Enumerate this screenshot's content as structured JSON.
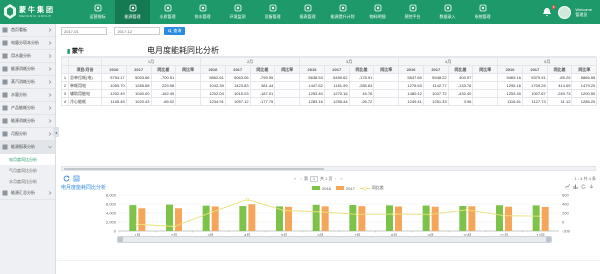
{
  "brand": {
    "name": "蒙牛集团",
    "sub": "MENGNIU GROUP",
    "primary_color": "#1e9a6a"
  },
  "nav": [
    {
      "label": "运营指标",
      "icon": "monitor-icon"
    },
    {
      "label": "能源管理",
      "icon": "bolt-icon",
      "active": true
    },
    {
      "label": "水质管理",
      "icon": "drop-icon"
    },
    {
      "label": "排水管理",
      "icon": "pipe-icon"
    },
    {
      "label": "环境监测",
      "icon": "leaf-icon"
    },
    {
      "label": "设备管理",
      "icon": "gear-icon"
    },
    {
      "label": "报表管理",
      "icon": "report-icon"
    },
    {
      "label": "能源提升计划",
      "icon": "chart-up-icon"
    },
    {
      "label": "物料明细",
      "icon": "box-icon"
    },
    {
      "label": "预控平台",
      "icon": "shield-icon"
    },
    {
      "label": "数据录入",
      "icon": "edit-icon"
    },
    {
      "label": "系统管理",
      "icon": "settings-icon"
    }
  ],
  "notifications": {
    "count": "8"
  },
  "user": {
    "greeting": "Welcome",
    "name": "管理员"
  },
  "sidebar": {
    "items": [
      {
        "label": "首页看板",
        "open": false
      },
      {
        "label": "电量分项本分析",
        "open": false
      },
      {
        "label": "用水量分析",
        "open": false
      },
      {
        "label": "能源消耗分析",
        "open": false
      },
      {
        "label": "蒸汽消耗分析",
        "open": false
      },
      {
        "label": "水量分析",
        "open": false
      },
      {
        "label": "产品能耗分析",
        "open": false
      },
      {
        "label": "能源消耗分析",
        "open": false
      },
      {
        "label": "月报分析",
        "open": false
      },
      {
        "label": "能源报表分析",
        "open": true
      }
    ],
    "subitems": [
      {
        "label": "电月度同比分析",
        "active": true
      },
      {
        "label": "气月度同比分析",
        "active": false
      },
      {
        "label": "水月度同比分析",
        "active": false
      }
    ],
    "last_item": {
      "label": "能源汇总分析"
    },
    "collapse_glyph": "◂"
  },
  "filter": {
    "start": "2017-01",
    "end": "2017-12",
    "dash": "-",
    "query_label": "查询"
  },
  "report": {
    "logo_green": "蒙牛",
    "logo_mark": "▮",
    "title": "电月度能耗同比分析"
  },
  "table": {
    "project_header": "项目/月份",
    "months": [
      "1月",
      "2月",
      "3月",
      "4月",
      "5月"
    ],
    "year_labels": [
      "2016",
      "2017",
      "同比差",
      "同比率"
    ],
    "rows": [
      {
        "no": "1",
        "name": "总单位耗(电)",
        "cells": [
          "5754.17",
          "5053.66",
          "-700.51",
          "",
          "5862.61",
          "5063.06",
          "-799.55",
          "",
          "5638.53",
          "5459.62",
          "-178.91",
          "",
          "5547.65",
          "5948.22",
          "400.57",
          "",
          "5469.16",
          "5379.91",
          "-89.25",
          "5866.55"
        ]
      },
      {
        "no": "2",
        "name": "单耗用电",
        "cells": [
          "1055.70",
          "1285.68",
          "229.98",
          "",
          "1042.39",
          "1423.83",
          "381.44",
          "",
          "1447.62",
          "1161.99",
          "-285.63",
          "",
          "1276.53",
          "1142.77",
          "-133.76",
          "",
          "1295.16",
          "1709.25",
          "414.09",
          "1479.20"
        ]
      },
      {
        "no": "3",
        "name": "辅助用能电",
        "cells": [
          "1202.49",
          "1040.00",
          "-162.49",
          "",
          "1202.04",
          "1015.03",
          "-187.01",
          "",
          "1253.40",
          "1270.16",
          "16.76",
          "",
          "1480.12",
          "1047.72",
          "-432.40",
          "",
          "1253.40",
          "1007.67",
          "-245.73",
          "1200.50"
        ]
      },
      {
        "no": "4",
        "name": "冷心能耗",
        "cells": [
          "1105.45",
          "1020.43",
          "-85.02",
          "",
          "1234.91",
          "1057.12",
          "-177.79",
          "",
          "1283.16",
          "1255.44",
          "-26.72",
          "",
          "1249.41",
          "1251.33",
          "3.96",
          "",
          "1116.61",
          "1127.73",
          "11.12",
          "1286.20"
        ]
      }
    ]
  },
  "pager": {
    "first": "«",
    "prev": "‹",
    "page_prefix": "第",
    "page": "1",
    "page_suffix": "共 1 页",
    "next": "›",
    "last": "»",
    "info": "1 - 4  共 4 条"
  },
  "chart_data": {
    "type": "bar",
    "title": "电月度能耗同比分析",
    "categories": [
      "1月",
      "2月",
      "3月",
      "4月",
      "5月",
      "6月",
      "7月",
      "8月",
      "9月",
      "10月",
      "11月",
      "12月"
    ],
    "series": [
      {
        "name": "2016",
        "type": "bar",
        "color": "#7dc34a",
        "values": [
          5754,
          5863,
          5639,
          5548,
          5469,
          5820,
          5780,
          5700,
          5650,
          5560,
          5720,
          5690
        ]
      },
      {
        "name": "2017",
        "type": "bar",
        "color": "#f6a65a",
        "values": [
          5054,
          5063,
          5460,
          5948,
          5380,
          5480,
          5520,
          5450,
          5390,
          5500,
          5400,
          5350
        ]
      },
      {
        "name": "同比差",
        "type": "line",
        "axis": "right",
        "color": "#e8e07a",
        "values": [
          -700,
          -800,
          -179,
          401,
          -89,
          -150,
          -260,
          -250,
          -260,
          -60,
          -320,
          -340
        ]
      }
    ],
    "ylabels_left": [
      "8,000",
      "6,000",
      "4,000",
      "2,000",
      "0"
    ],
    "ylim": [
      0,
      8000
    ],
    "ylabels_right": [
      "600",
      "400",
      "200",
      "0",
      "-200"
    ],
    "ylim_right": [
      -1000,
      600
    ],
    "grid": true,
    "legend": "top-center"
  }
}
